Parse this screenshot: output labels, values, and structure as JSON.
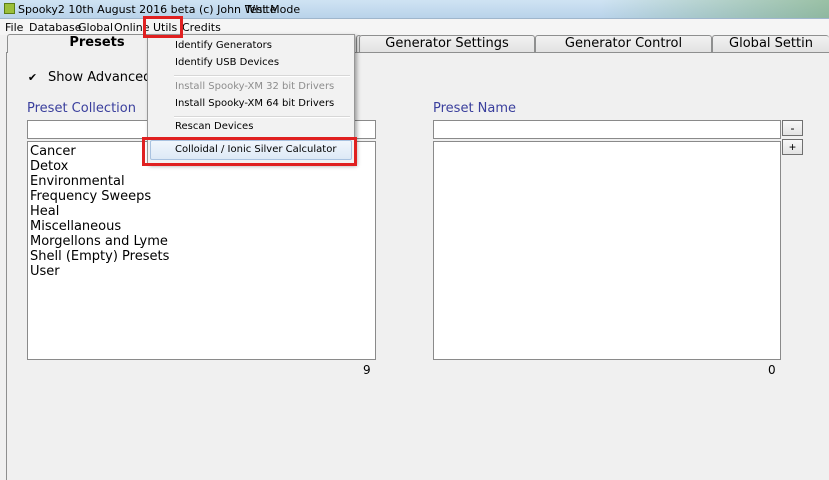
{
  "window": {
    "title": "Spooky2 10th August 2016 beta (c) John White",
    "mode": "Test Mode"
  },
  "menubar": {
    "items": [
      "File",
      "Database",
      "Global",
      "Online",
      "Utils",
      "Credits"
    ]
  },
  "tabs": [
    "Presets",
    "",
    "Generator Settings",
    "Generator Control",
    "Global Settin"
  ],
  "presets": {
    "show_advanced_label": "Show Advanced C",
    "show_advanced_checked": true,
    "collection_label": "Preset Collection",
    "collection_filter": "",
    "collection_items": [
      "Cancer",
      "Detox",
      "Environmental",
      "Frequency Sweeps",
      "Heal",
      "Miscellaneous",
      "Morgellons and Lyme",
      "Shell (Empty) Presets",
      "User"
    ],
    "collection_count": "9",
    "name_label": "Preset Name",
    "name_filter": "",
    "name_count": "0",
    "minus_label": "-",
    "plus_label": "+"
  },
  "utils_menu": {
    "identify_generators": "Identify Generators",
    "identify_usb": "Identify USB Devices",
    "install_32": "Install Spooky-XM 32 bit Drivers",
    "install_64": "Install Spooky-XM 64 bit Drivers",
    "rescan": "Rescan Devices",
    "silver_calc": "Colloidal / Ionic Silver Calculator"
  },
  "colors": {
    "highlight_box": "#e02020",
    "section_label": "#3a3f9d"
  },
  "icons": {
    "app": "spooky2-app-icon",
    "check": "checkmark-icon"
  }
}
